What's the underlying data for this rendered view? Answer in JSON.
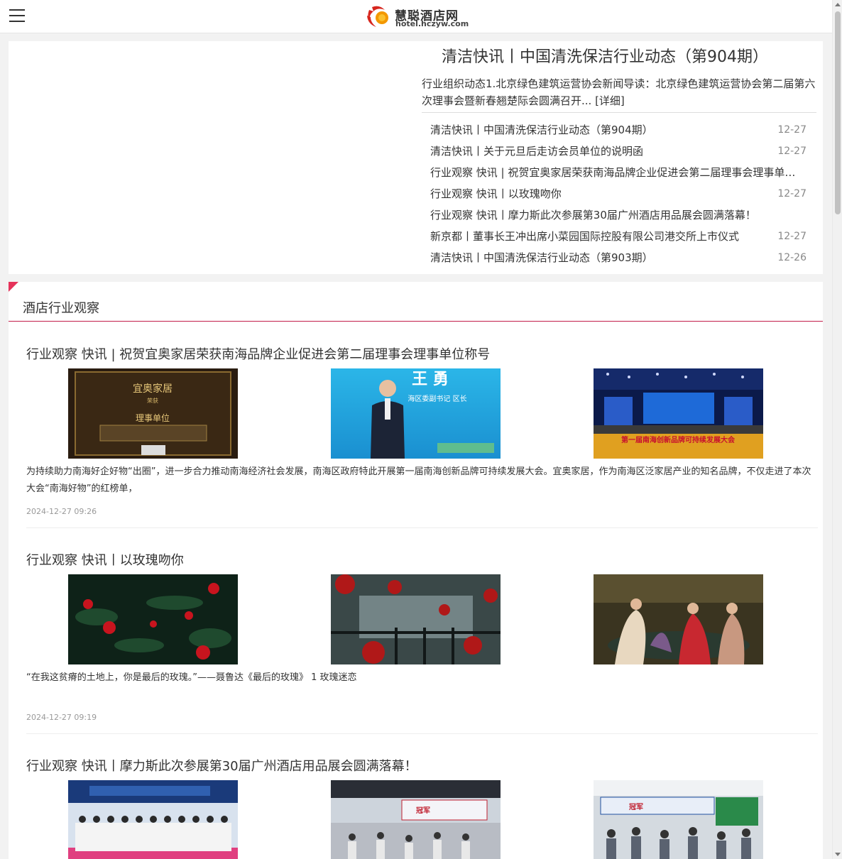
{
  "header": {
    "logo_cn": "慧聪酒店网",
    "logo_en": "hotel.hczyw.com"
  },
  "featured": {
    "title": "清洁快讯丨中国清洗保洁行业动态（第904期）",
    "summary": "行业组织动态1.北京绿色建筑运营协会新闻导读：北京绿色建筑运营协会第二届第六次理事会暨新春翘楚际会圆满召开... [详细]"
  },
  "news_list": [
    {
      "title": "清洁快讯丨中国清洗保洁行业动态（第904期）",
      "date": "12-27"
    },
    {
      "title": "清洁快讯丨关于元旦后走访会员单位的说明函",
      "date": "12-27"
    },
    {
      "title": "行业观察 快讯 | 祝贺宜奥家居荣获南海品牌企业促进会第二届理事会理事单位称号",
      "date": ""
    },
    {
      "title": "行业观察 快讯丨以玫瑰吻你",
      "date": "12-27"
    },
    {
      "title": "行业观察 快讯丨摩力斯此次参展第30届广州酒店用品展会圆满落幕！",
      "date": ""
    },
    {
      "title": "新京都丨董事长王冲出席小菜园国际控股有限公司港交所上市仪式",
      "date": "12-27"
    },
    {
      "title": "清洁快讯丨中国清洗保洁行业动态（第903期）",
      "date": "12-26"
    }
  ],
  "section": {
    "title": "酒店行业观察"
  },
  "articles": [
    {
      "title": "行业观察 快讯 | 祝贺宜奥家居荣获南海品牌企业促进会第二届理事会理事单位称号",
      "summary": "为持续助力南海好企好物“出圈”，进一步合力推动南海经济社会发展，南海区政府特此开展第一届南海创新品牌可持续发展大会。宜奥家居，作为南海区泛家居产业的知名品牌，不仅走进了本次大会“南海好物”的红榜单，",
      "date": "2024-12-27 09:26",
      "images": [
        "award-plaque",
        "speaker-on-stage",
        "conference-hall"
      ],
      "img_text": {
        "plaque_1": "宜奥家居",
        "plaque_2": "荣获",
        "plaque_3": "理事单位",
        "stage_name": "王 勇",
        "stage_sub": "海区委副书记  区长",
        "hall_banner": "第一届南海创新品牌可持续发展大会"
      }
    },
    {
      "title": "行业观察 快讯丨以玫瑰吻你",
      "summary": "“在我这贫瘠的土地上，你是最后的玫瑰。”——聂鲁达《最后的玫瑰》 1 玫瑰迷恋",
      "date": "2024-12-27 09:19",
      "images": [
        "red-roses-dark",
        "roses-fence",
        "painting-women"
      ]
    },
    {
      "title": "行业观察 快讯丨摩力斯此次参展第30届广州酒店用品展会圆满落幕！",
      "summary": "",
      "date": "",
      "images": [
        "exhibition-group-photo",
        "exhibition-booth",
        "exhibition-crowd"
      ],
      "img_text": {
        "booth_1": "冠军",
        "booth_2": "冠军"
      }
    }
  ],
  "colors": {
    "accent": "#c21e4a",
    "corner": "#e5335a",
    "logo_red": "#d7261e",
    "logo_orange": "#f39800"
  }
}
